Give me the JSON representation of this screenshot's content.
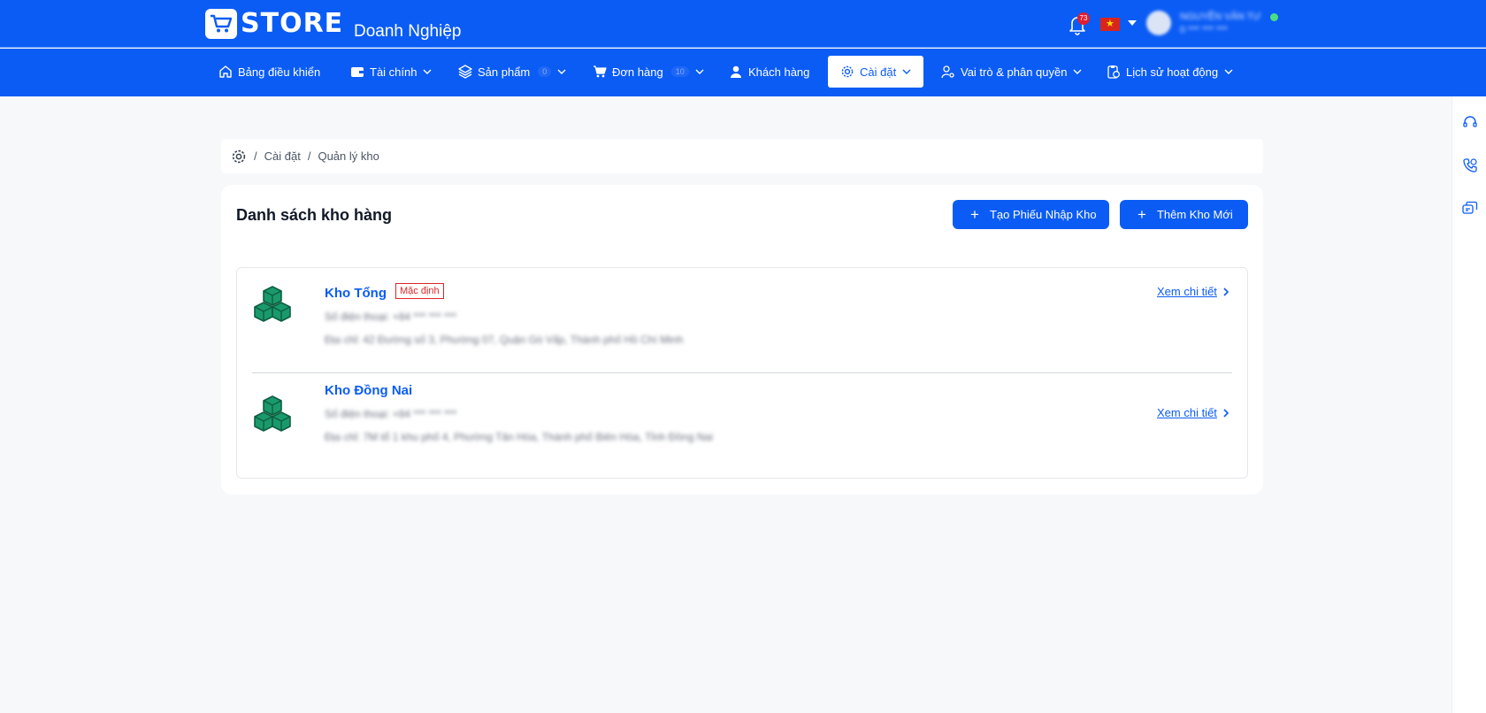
{
  "header": {
    "logo_text": "STORE",
    "brand_sub": "Doanh Nghiệp",
    "notification_count": "73",
    "user_name": "NGUYỄN VĂN TƯ",
    "user_phone": "0 *** *** ***"
  },
  "nav": {
    "items": [
      {
        "label": "Bảng điều khiển",
        "icon": "home-icon"
      },
      {
        "label": "Tài chính",
        "icon": "wallet-icon"
      },
      {
        "label": "Sản phẩm",
        "icon": "layers-icon",
        "count": "0"
      },
      {
        "label": "Đơn hàng",
        "icon": "cart-icon",
        "count": "10"
      },
      {
        "label": "Khách hàng",
        "icon": "user-icon"
      },
      {
        "label": "Cài đặt",
        "icon": "gear-icon"
      },
      {
        "label": "Vai trò & phân quyền",
        "icon": "user-settings-icon"
      },
      {
        "label": "Lịch sử hoạt động",
        "icon": "clipboard-clock-icon"
      }
    ],
    "active": "Cài đặt"
  },
  "breadcrumb": {
    "items": [
      "Cài đặt",
      "Quản lý kho"
    ],
    "separator": "/"
  },
  "main": {
    "title": "Danh sách kho hàng",
    "create_receipt_label": "Tạo Phiếu Nhập Kho",
    "add_warehouse_label": "Thêm Kho Mới",
    "detail_link_label": "Xem chi tiết",
    "warehouses": [
      {
        "name": "Kho Tổng",
        "badge": "Mặc định",
        "phone": "Số điện thoại: +84 *** *** ***",
        "address": "Địa chỉ: 42 Đường số 3, Phường 07, Quận Gò Vấp, Thành phố Hồ Chí Minh"
      },
      {
        "name": "Kho Đồng Nai",
        "badge": "",
        "phone": "Số điện thoại: +84 *** *** ***",
        "address": "Địa chỉ: 7M tổ 1 khu phố 4, Phường Tân Hòa, Thành phố Biên Hòa, Tỉnh Đồng Nai"
      }
    ]
  },
  "colors": {
    "primary": "#0b5cf5",
    "badge_red": "#dc2626",
    "warehouse_icon_green": "#1a9a6c"
  },
  "right_rail_icons": [
    "headset-icon",
    "phone-call-icon",
    "chat-icon"
  ]
}
